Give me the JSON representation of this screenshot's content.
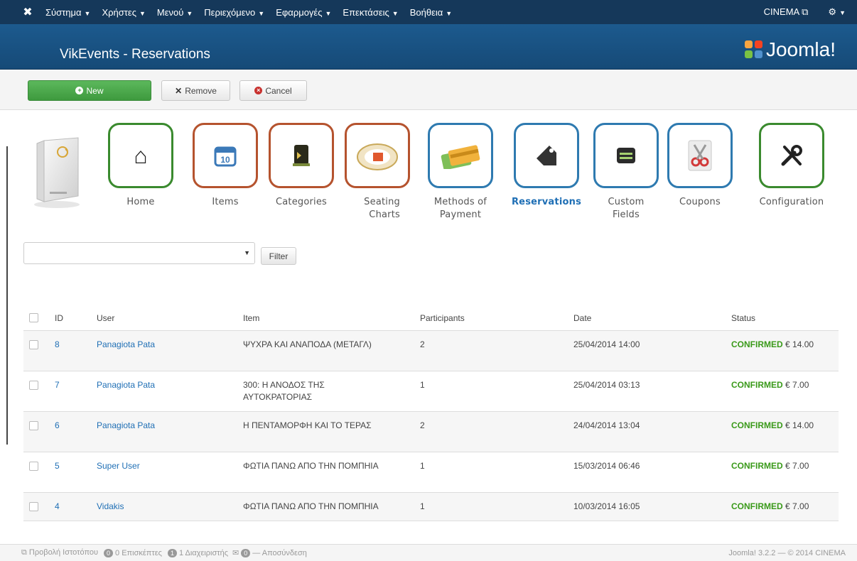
{
  "navbar": {
    "menus": [
      "Σύστημα",
      "Χρήστες",
      "Μενού",
      "Περιεχόμενο",
      "Εφαρμογές",
      "Επεκτάσεις",
      "Βοήθεια"
    ],
    "site_name": "CINEMA"
  },
  "header": {
    "title": "VikEvents - Reservations",
    "brand": "Joomla!"
  },
  "toolbar": {
    "new_label": "New",
    "remove_label": "Remove",
    "cancel_label": "Cancel"
  },
  "nav_icons": [
    {
      "label": "Home",
      "color": "#3a8a2e"
    },
    {
      "label": "Items",
      "color": "#b5532e"
    },
    {
      "label": "Categories",
      "color": "#b5532e"
    },
    {
      "label": "Seating Charts",
      "color": "#b5532e"
    },
    {
      "label": "Methods of Payment",
      "color": "#2e7ab0"
    },
    {
      "label": "Reservations",
      "color": "#2e7ab0"
    },
    {
      "label": "Custom Fields",
      "color": "#2e7ab0"
    },
    {
      "label": "Coupons",
      "color": "#2e7ab0"
    },
    {
      "label": "Configuration",
      "color": "#3a8a2e"
    }
  ],
  "filter": {
    "button_label": "Filter",
    "selected": ""
  },
  "table": {
    "headers": {
      "id": "ID",
      "user": "User",
      "item": "Item",
      "participants": "Participants",
      "date": "Date",
      "status": "Status"
    },
    "rows": [
      {
        "id": "8",
        "user": "Panagiota Pata",
        "item": "ΨΥΧΡΑ ΚΑΙ ΑΝΑΠΟΔΑ (ΜΕΤΑΓΛ)",
        "participants": "2",
        "date": "25/04/2014 14:00",
        "status": "CONFIRMED",
        "amount": "€ 14.00"
      },
      {
        "id": "7",
        "user": "Panagiota Pata",
        "item": "300: Η ΑΝΟΔΟΣ ΤΗΣ ΑΥΤΟΚΡΑΤΟΡΙΑΣ",
        "participants": "1",
        "date": "25/04/2014 03:13",
        "status": "CONFIRMED",
        "amount": "€ 7.00"
      },
      {
        "id": "6",
        "user": "Panagiota Pata",
        "item": "Η ΠΕΝΤΑΜΟΡΦΗ ΚΑΙ ΤΟ ΤΕΡΑΣ",
        "participants": "2",
        "date": "24/04/2014 13:04",
        "status": "CONFIRMED",
        "amount": "€ 14.00"
      },
      {
        "id": "5",
        "user": "Super User",
        "item": "ΦΩΤΙΑ ΠΑΝΩ ΑΠΟ ΤΗΝ ΠΟΜΠΗΙΑ",
        "participants": "1",
        "date": "15/03/2014 06:46",
        "status": "CONFIRMED",
        "amount": "€ 7.00"
      },
      {
        "id": "4",
        "user": "Vidakis",
        "item": "ΦΩΤΙΑ ΠΑΝΩ ΑΠΟ ΤΗΝ ΠΟΜΠΗΙΑ",
        "participants": "1",
        "date": "10/03/2014 16:05",
        "status": "CONFIRMED",
        "amount": "€ 7.00"
      }
    ]
  },
  "footer": {
    "preview": "Προβολή Ιστοτόπου",
    "visitors_count": "0",
    "visitors": "0 Επισκέπτες",
    "admins_count": "1",
    "admins": "1 Διαχειριστής",
    "messages_count": "0",
    "logout": "— Αποσύνδεση",
    "version": "Joomla! 3.2.2 — © 2014 CINEMA"
  }
}
